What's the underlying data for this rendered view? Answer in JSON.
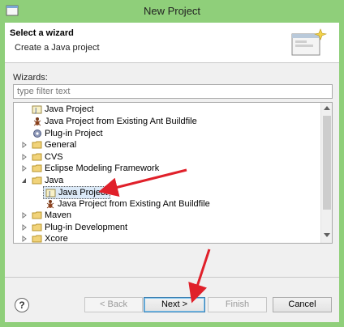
{
  "window": {
    "title": "New Project"
  },
  "header": {
    "title": "Select a wizard",
    "subtitle": "Create a Java project"
  },
  "wizards": {
    "label": "Wizards:",
    "filter_placeholder": "type filter text",
    "filter_value": ""
  },
  "tree": {
    "items": [
      {
        "label": "Java Project",
        "icon": "java-project-icon"
      },
      {
        "label": "Java Project from Existing Ant Buildfile",
        "icon": "ant-icon"
      },
      {
        "label": "Plug-in Project",
        "icon": "plugin-icon"
      },
      {
        "label": "General",
        "icon": "folder-icon",
        "expanded": false
      },
      {
        "label": "CVS",
        "icon": "folder-icon",
        "expanded": false
      },
      {
        "label": "Eclipse Modeling Framework",
        "icon": "folder-icon",
        "expanded": false
      },
      {
        "label": "Java",
        "icon": "folder-icon",
        "expanded": true
      },
      {
        "label": "Java Project",
        "icon": "java-project-icon",
        "selected": true
      },
      {
        "label": "Java Project from Existing Ant Buildfile",
        "icon": "ant-icon"
      },
      {
        "label": "Maven",
        "icon": "folder-icon",
        "expanded": false
      },
      {
        "label": "Plug-in Development",
        "icon": "folder-icon",
        "expanded": false
      },
      {
        "label": "Xcore",
        "icon": "folder-icon",
        "expanded": false
      }
    ]
  },
  "buttons": {
    "help": "?",
    "back": "< Back",
    "next": "Next >",
    "finish": "Finish",
    "cancel": "Cancel"
  },
  "colors": {
    "frame": "#8fcf7a",
    "annotation_arrow": "#e0202a",
    "default_button_border": "#3c7fb1"
  }
}
